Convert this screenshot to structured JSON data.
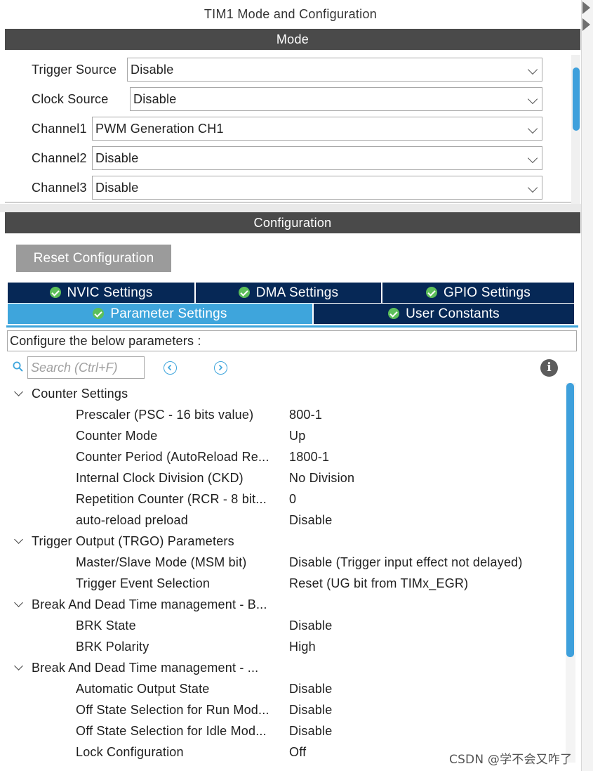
{
  "window": {
    "title": "TIM1 Mode and Configuration"
  },
  "mode": {
    "header": "Mode",
    "fields": [
      {
        "label": "Trigger Source",
        "value": "Disable"
      },
      {
        "label": "Clock Source",
        "value": "Disable"
      },
      {
        "label": "Channel1",
        "value": "PWM Generation CH1"
      },
      {
        "label": "Channel2",
        "value": "Disable"
      },
      {
        "label": "Channel3",
        "value": "Disable"
      }
    ]
  },
  "configuration": {
    "header": "Configuration",
    "reset_label": "Reset Configuration",
    "tabs": [
      {
        "label": "NVIC Settings"
      },
      {
        "label": "DMA Settings"
      },
      {
        "label": "GPIO Settings"
      },
      {
        "label": "Parameter Settings"
      },
      {
        "label": "User Constants"
      }
    ],
    "active_tab": "Parameter Settings",
    "description": "Configure the below parameters :",
    "search": {
      "placeholder": "Search (Ctrl+F)"
    },
    "groups": [
      {
        "label": "Counter Settings",
        "params": [
          {
            "name": "Prescaler (PSC - 16 bits value)",
            "value": "800-1"
          },
          {
            "name": "Counter Mode",
            "value": "Up"
          },
          {
            "name": "Counter Period (AutoReload Re...",
            "value": "1800-1"
          },
          {
            "name": "Internal Clock Division (CKD)",
            "value": "No Division"
          },
          {
            "name": "Repetition Counter (RCR - 8 bit...",
            "value": "0"
          },
          {
            "name": "auto-reload preload",
            "value": "Disable"
          }
        ]
      },
      {
        "label": "Trigger Output (TRGO) Parameters",
        "params": [
          {
            "name": "Master/Slave Mode (MSM bit)",
            "value": "Disable (Trigger input effect not delayed)"
          },
          {
            "name": "Trigger Event Selection",
            "value": "Reset (UG bit from TIMx_EGR)"
          }
        ]
      },
      {
        "label": "Break And Dead Time management - B...",
        "params": [
          {
            "name": "BRK State",
            "value": "Disable"
          },
          {
            "name": "BRK Polarity",
            "value": "High"
          }
        ]
      },
      {
        "label": "Break And Dead Time management - ...",
        "params": [
          {
            "name": "Automatic Output State",
            "value": "Disable"
          },
          {
            "name": "Off State Selection for Run Mod...",
            "value": "Disable"
          },
          {
            "name": "Off State Selection for Idle Mod...",
            "value": "Disable"
          },
          {
            "name": "Lock Configuration",
            "value": "Off"
          }
        ]
      }
    ]
  },
  "watermark": "CSDN @学不会又咋了",
  "colors": {
    "accent": "#3ea5dc",
    "tab_dark": "#062856",
    "header_bar": "#4a4a4a",
    "check": "#5cbf5a"
  }
}
